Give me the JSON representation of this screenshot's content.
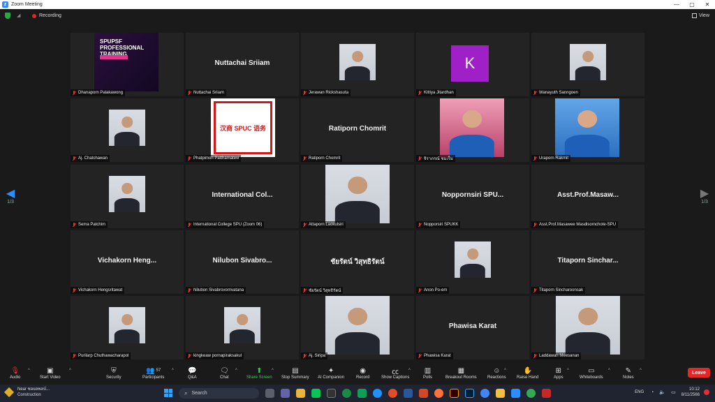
{
  "window": {
    "title": "Zoom Meeting",
    "minimize": "—",
    "maximize": "▢",
    "close": "✕"
  },
  "topbar": {
    "recording_label": "Recording",
    "view_label": "View"
  },
  "pager": {
    "left_page": "1/3",
    "right_page": "1/3"
  },
  "tiles": [
    {
      "label": "Dhanaporn Palakawong",
      "display": "",
      "photo": "poster",
      "poster_text": "SPUPSF PROFESSIONAL TRAINING"
    },
    {
      "label": "Nuttachai Sriiam",
      "display": "Nuttachai Sriiam",
      "photo": ""
    },
    {
      "label": "Jerawan Rickshasuta",
      "display": "",
      "photo": "person"
    },
    {
      "label": "Kittiya Jitardhan",
      "display": "",
      "photo": "k",
      "avatar_letter": "K"
    },
    {
      "label": "Wanayuth Sanngoen",
      "display": "",
      "photo": "person"
    },
    {
      "label": "Aj. Chatchawan",
      "display": "",
      "photo": "person"
    },
    {
      "label": "Phatpimon Patthamatevi",
      "display": "",
      "photo": "chinese",
      "logo_text": "汉商 SPUC 语务"
    },
    {
      "label": "Ratiporn Chomrit",
      "display": "Ratiporn Chomrit",
      "photo": ""
    },
    {
      "label": "จิราภรณ์ ชมเร็ม",
      "display": "",
      "photo": "pink"
    },
    {
      "label": "Uraporn Rakmit",
      "display": "",
      "photo": "blue"
    },
    {
      "label": "Sema Patchim",
      "display": "",
      "photo": "person"
    },
    {
      "label": "International College SPU (Zoom 06)",
      "display": "International  Col...",
      "photo": ""
    },
    {
      "label": "Attaporn Laokulsiri",
      "display": "",
      "photo": "person"
    },
    {
      "label": "Nopporsiri SPUKK",
      "display": "Noppornsiri  SPU...",
      "photo": ""
    },
    {
      "label": "Asst.Prof.Masawee Masdisornchote-SPU",
      "display": "Asst.Prof.Masaw...",
      "photo": ""
    },
    {
      "label": "Vichakorn Hengsritawat",
      "display": "Vichakorn  Heng...",
      "photo": ""
    },
    {
      "label": "Nilubon Sivabrovornvatana",
      "display": "Nilubon  Sivabro...",
      "photo": ""
    },
    {
      "label": "ชัยรัตน์ วิสุทธิรัตน์",
      "display": "ชัยรัตน์  วิสุทธิรัตน์",
      "photo": ""
    },
    {
      "label": "Anon Po-em",
      "display": "",
      "photo": "person"
    },
    {
      "label": "Titaporn Sincharoonsak",
      "display": "Titaporn  Sinchar...",
      "photo": ""
    },
    {
      "label": "Purilarp Chuthawacharapol",
      "display": "",
      "photo": "person"
    },
    {
      "label": "kingkeaw pornapiraksakul",
      "display": "",
      "photo": "person"
    },
    {
      "label": "Aj. Siripa",
      "display": "",
      "photo": "person"
    },
    {
      "label": "Phawisa Karat",
      "display": "Phawisa Karat",
      "photo": ""
    },
    {
      "label": "Laddawan Meesanan",
      "display": "",
      "photo": "person"
    }
  ],
  "toolbar": {
    "audio": "Audio",
    "start_video": "Start Video",
    "security": "Security",
    "participants": "Participants",
    "participants_count": "57",
    "qa": "Q&A",
    "chat": "Chat",
    "share_screen": "Share Screen",
    "stop_summary": "Stop Summary",
    "ai_companion": "AI Companion",
    "record": "Record",
    "show_captions": "Show Captions",
    "polls": "Polls",
    "breakout_rooms": "Breakout Rooms",
    "reactions": "Reactions",
    "raise_hand": "Raise Hand",
    "apps": "Apps",
    "whiteboards": "Whiteboards",
    "notes": "Notes",
    "leave": "Leave"
  },
  "taskbar": {
    "weather_line1": "Near ซอยลพลบ์...",
    "weather_line2": "Construction",
    "search_placeholder": "Search",
    "lang": "ENG",
    "time": "10:12",
    "date": "8/11/2566"
  },
  "colors": {
    "accent": "#2d8cff",
    "leave": "#e02828",
    "share": "#3ccf4e",
    "record_dot": "#e02828"
  }
}
